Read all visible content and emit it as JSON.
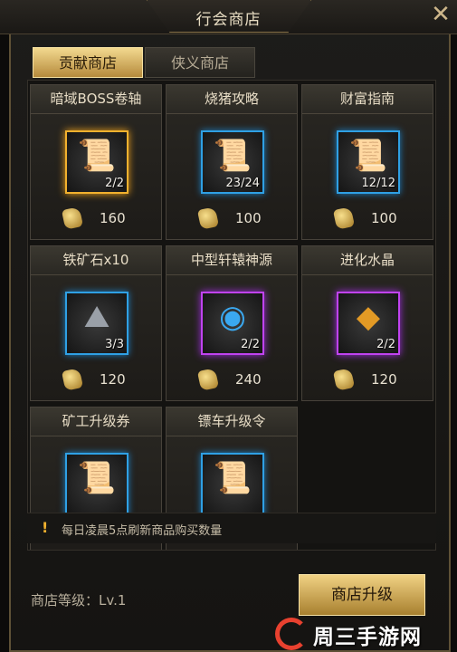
{
  "window": {
    "title": "行会商店"
  },
  "tabs": [
    {
      "label": "贡献商店",
      "active": true
    },
    {
      "label": "侠义商店",
      "active": false
    }
  ],
  "items": [
    {
      "name": "暗域BOSS卷轴",
      "count": "2/2",
      "price": "160",
      "rarity": "gold",
      "icon": "scroll-icon"
    },
    {
      "name": "烧猪攻略",
      "count": "23/24",
      "price": "100",
      "rarity": "blue",
      "icon": "scroll-icon"
    },
    {
      "name": "财富指南",
      "count": "12/12",
      "price": "100",
      "rarity": "blue",
      "icon": "scroll-icon"
    },
    {
      "name": "铁矿石x10",
      "count": "3/3",
      "price": "120",
      "rarity": "blue",
      "icon": "ore-icon"
    },
    {
      "name": "中型轩辕神源",
      "count": "2/2",
      "price": "240",
      "rarity": "purple",
      "icon": "orb-icon"
    },
    {
      "name": "进化水晶",
      "count": "2/2",
      "price": "120",
      "rarity": "purple",
      "icon": "crystal-icon"
    },
    {
      "name": "矿工升级券",
      "count": "",
      "price": "",
      "rarity": "blue",
      "icon": "scroll-icon"
    },
    {
      "name": "镖车升级令",
      "count": "",
      "price": "",
      "rarity": "blue",
      "icon": "scroll-icon"
    }
  ],
  "notice": {
    "text": "每日凌晨5点刷新商品购买数量"
  },
  "footer": {
    "level_label": "商店等级：Lv.1",
    "upgrade_label": "商店升级"
  },
  "watermark": {
    "text": "周三手游网"
  }
}
